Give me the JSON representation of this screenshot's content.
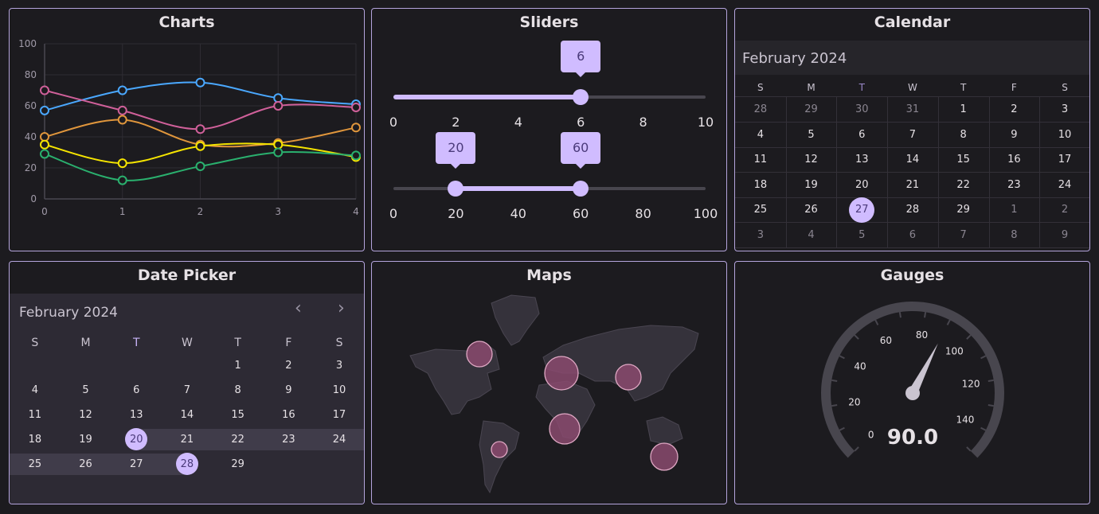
{
  "panels": {
    "charts": "Charts",
    "sliders": "Sliders",
    "calendar": "Calendar",
    "datepicker": "Date Picker",
    "maps": "Maps",
    "gauges": "Gauges"
  },
  "colors": {
    "accent": "#d0bcff",
    "border": "#b4a4dc",
    "bubble": "#8a4a6e"
  },
  "chart_data": {
    "type": "line",
    "x": [
      0,
      1,
      2,
      3,
      4
    ],
    "ylim": [
      0,
      100
    ],
    "yticks": [
      0,
      20,
      40,
      60,
      80,
      100
    ],
    "grid": true,
    "series": [
      {
        "name": "blue",
        "color": "#4aa8ff",
        "values": [
          57,
          70,
          75,
          65,
          61
        ]
      },
      {
        "name": "pink",
        "color": "#d0609a",
        "values": [
          70,
          57,
          45,
          60,
          59
        ]
      },
      {
        "name": "orange",
        "color": "#e0963c",
        "values": [
          40,
          51,
          35,
          36,
          46
        ]
      },
      {
        "name": "yellow",
        "color": "#f5e400",
        "values": [
          35,
          23,
          34,
          35,
          27
        ]
      },
      {
        "name": "green",
        "color": "#2ab06e",
        "values": [
          29,
          12,
          21,
          30,
          28
        ]
      }
    ]
  },
  "slider1": {
    "min": 0,
    "max": 10,
    "value": 6,
    "value_label": "6",
    "ticks": [
      "0",
      "2",
      "4",
      "6",
      "8",
      "10"
    ]
  },
  "slider2": {
    "min": 0,
    "max": 100,
    "low": 20,
    "high": 60,
    "low_label": "20",
    "high_label": "60",
    "ticks": [
      "0",
      "20",
      "40",
      "60",
      "80",
      "100"
    ]
  },
  "calendar": {
    "month": "February 2024",
    "weekdays": [
      "S",
      "M",
      "T",
      "W",
      "T",
      "F",
      "S"
    ],
    "today_col": 2,
    "days": [
      [
        "28",
        "29",
        "30",
        "31",
        "1",
        "2",
        "3"
      ],
      [
        "4",
        "5",
        "6",
        "7",
        "8",
        "9",
        "10"
      ],
      [
        "11",
        "12",
        "13",
        "14",
        "15",
        "16",
        "17"
      ],
      [
        "18",
        "19",
        "20",
        "21",
        "22",
        "23",
        "24"
      ],
      [
        "25",
        "26",
        "27",
        "28",
        "29",
        "1",
        "2"
      ],
      [
        "3",
        "4",
        "5",
        "6",
        "7",
        "8",
        "9"
      ]
    ],
    "muted": [
      [
        0,
        0
      ],
      [
        0,
        1
      ],
      [
        0,
        2
      ],
      [
        0,
        3
      ],
      [
        4,
        5
      ],
      [
        4,
        6
      ],
      [
        5,
        0
      ],
      [
        5,
        1
      ],
      [
        5,
        2
      ],
      [
        5,
        3
      ],
      [
        5,
        4
      ],
      [
        5,
        5
      ],
      [
        5,
        6
      ]
    ],
    "selected": "27"
  },
  "datepicker": {
    "month": "February 2024",
    "prev": "‹",
    "next": "›",
    "weekdays": [
      "S",
      "M",
      "T",
      "W",
      "T",
      "F",
      "S"
    ],
    "days": [
      [
        "",
        "",
        "",
        "",
        "1",
        "2",
        "3"
      ],
      [
        "4",
        "5",
        "6",
        "7",
        "8",
        "9",
        "10"
      ],
      [
        "11",
        "12",
        "13",
        "14",
        "15",
        "16",
        "17"
      ],
      [
        "18",
        "19",
        "20",
        "21",
        "22",
        "23",
        "24"
      ],
      [
        "25",
        "26",
        "27",
        "28",
        "29",
        "",
        ""
      ]
    ],
    "range_start": "20",
    "range_end": "28"
  },
  "gauge": {
    "min": 0,
    "max": 150,
    "value": 90,
    "value_label": "90.0",
    "labels": [
      "0",
      "20",
      "40",
      "60",
      "80",
      "100",
      "120",
      "140"
    ]
  }
}
